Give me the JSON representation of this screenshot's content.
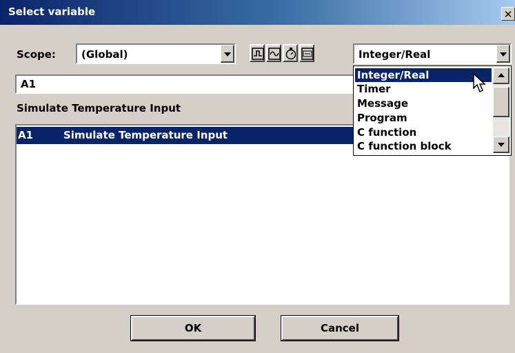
{
  "window": {
    "title": "Select variable",
    "close_label": "✕"
  },
  "scope": {
    "label": "Scope:",
    "value": "(Global)"
  },
  "toolbar": {
    "icons": [
      "digital-signal-icon",
      "analog-wave-icon",
      "timer-clock-icon",
      "message-icon"
    ]
  },
  "type_select": {
    "value": "Integer/Real",
    "options": [
      "Integer/Real",
      "Timer",
      "Message",
      "Program",
      "C function",
      "C function block"
    ],
    "selected_index": 0
  },
  "search": {
    "value": "A1"
  },
  "description": "Simulate Temperature Input",
  "variables": [
    {
      "name": "A1",
      "description": "Simulate Temperature Input",
      "selected": true
    }
  ],
  "buttons": {
    "ok": "OK",
    "cancel": "Cancel"
  },
  "colors": {
    "title_bar": "#0a246a",
    "selection": "#0a246a",
    "dialog_bg": "#d4d0c8"
  }
}
